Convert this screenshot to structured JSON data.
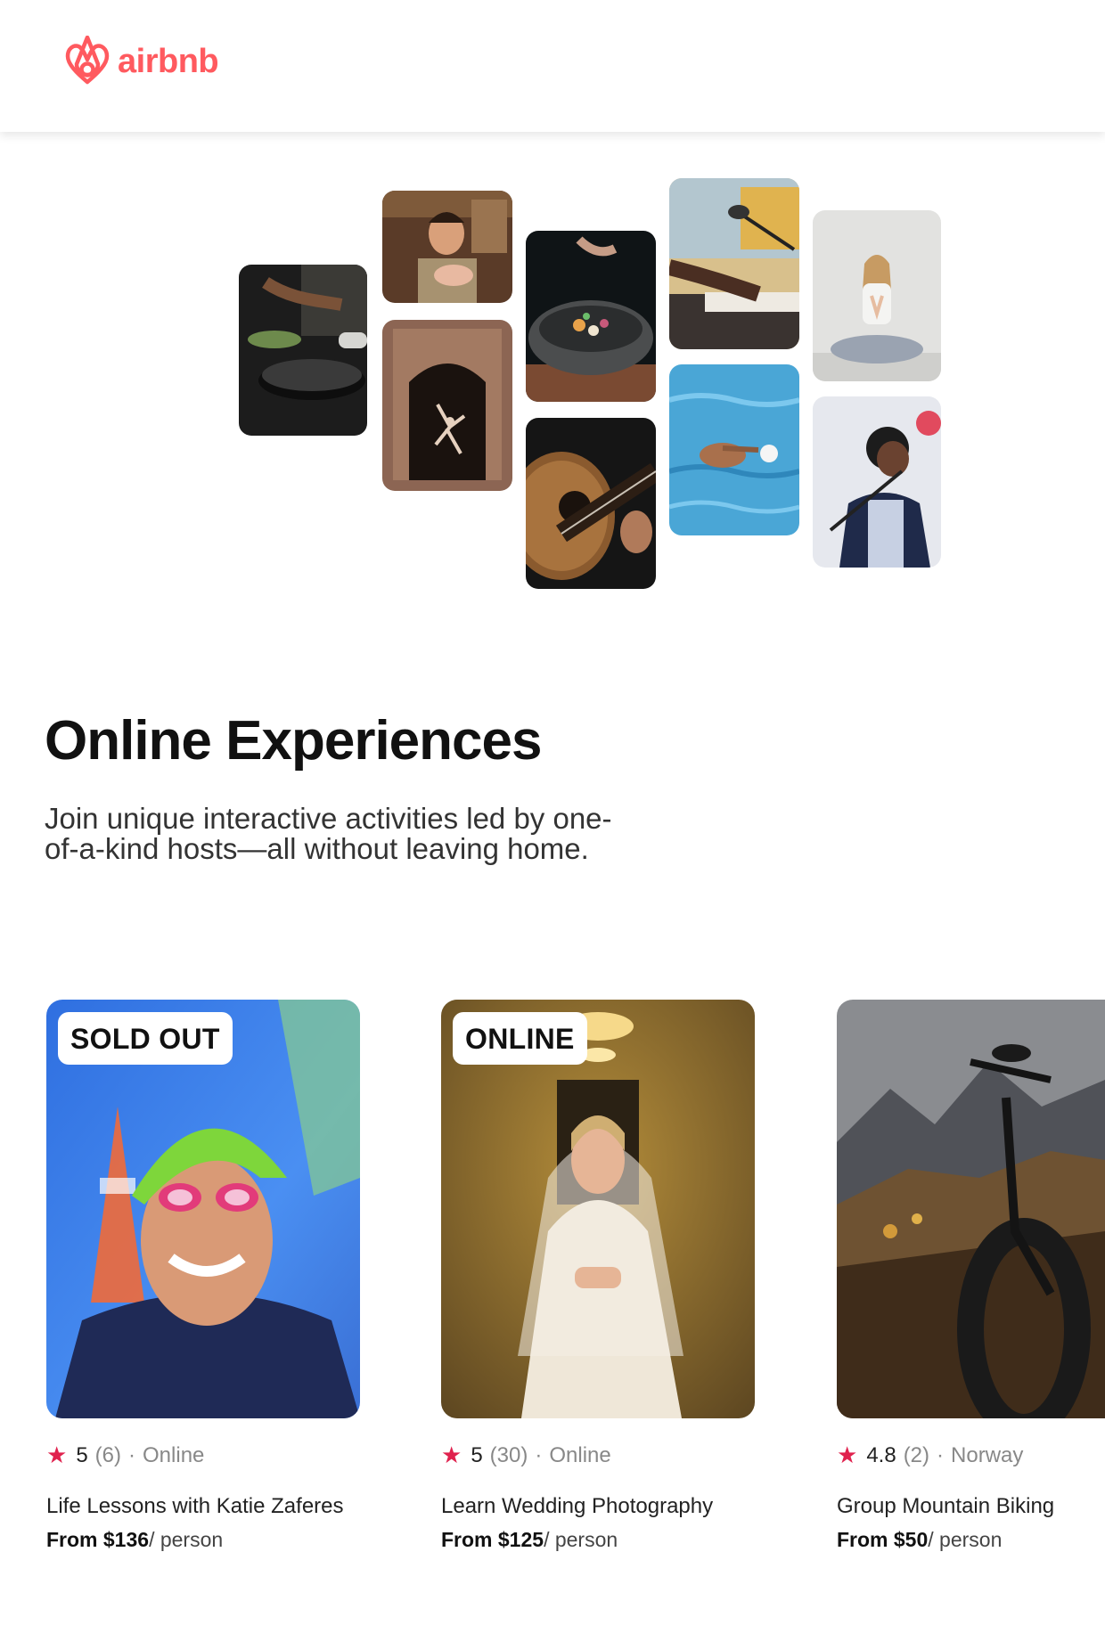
{
  "header": {
    "logo_text": "airbnb",
    "logo_icon": "airbnb-belo-icon",
    "brand_color": "#FF5A5F"
  },
  "collage": {
    "tiles": [
      {
        "name": "cooking-pan-photo"
      },
      {
        "name": "chef-portrait-photo"
      },
      {
        "name": "dancer-doorway-photo"
      },
      {
        "name": "plated-bowl-photo"
      },
      {
        "name": "acoustic-guitar-photo"
      },
      {
        "name": "piano-microphone-photo"
      },
      {
        "name": "swimmer-pool-photo"
      },
      {
        "name": "yoga-meditation-photo"
      },
      {
        "name": "singer-microphone-photo"
      }
    ]
  },
  "main": {
    "title": "Online Experiences",
    "subtitle": "Join unique interactive activities led by one-of-a-kind hosts—all without leaving home."
  },
  "cards": [
    {
      "badge": "SOLD OUT",
      "rating": "5",
      "count": "(6)",
      "separator": "·",
      "location": "Online",
      "title": "Life Lessons with Katie Zaferes",
      "price_prefix": "From $136",
      "price_suffix": "/ person"
    },
    {
      "badge": "ONLINE",
      "rating": "5",
      "count": "(30)",
      "separator": "·",
      "location": "Online",
      "title": "Learn Wedding Photography",
      "price_prefix": "From $125",
      "price_suffix": "/ person"
    },
    {
      "badge": "",
      "rating": "4.8",
      "count": "(2)",
      "separator": "·",
      "location": "Norway",
      "title": "Group Mountain Biking",
      "price_prefix": "From $50",
      "price_suffix": "/ person"
    }
  ],
  "star_color": "#E0224E"
}
